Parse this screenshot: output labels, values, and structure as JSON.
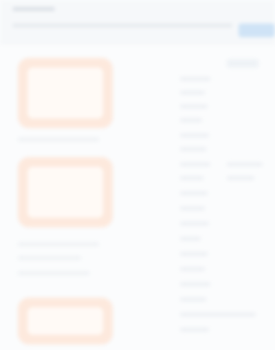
{
  "header": {
    "title": "",
    "action_label": ""
  },
  "cards": [
    {
      "label": ""
    },
    {
      "label": ""
    },
    {
      "label": ""
    }
  ],
  "colors": {
    "card_border": "#fde9dd",
    "card_fill": "#fffaf6",
    "accent_button": "#cfe3f6",
    "background": "#fbfcfd"
  }
}
